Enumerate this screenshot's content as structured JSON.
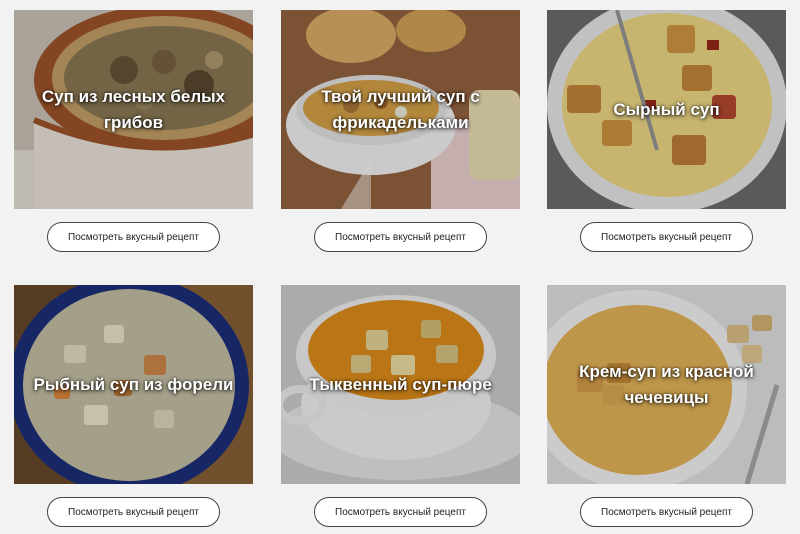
{
  "recipes": [
    {
      "title": "Суп из лесных белых грибов",
      "button": "Посмотреть вкусный рецепт"
    },
    {
      "title": "Твой лучший суп с фрикадельками",
      "button": "Посмотреть вкусный рецепт"
    },
    {
      "title": "Сырный суп",
      "button": "Посмотреть вкусный рецепт"
    },
    {
      "title": "Рыбный суп из форели",
      "button": "Посмотреть вкусный рецепт"
    },
    {
      "title": "Тыквенный суп-пюре",
      "button": "Посмотреть вкусный рецепт"
    },
    {
      "title": "Крем-суп из красной чечевицы",
      "button": "Посмотреть вкусный рецепт"
    }
  ]
}
